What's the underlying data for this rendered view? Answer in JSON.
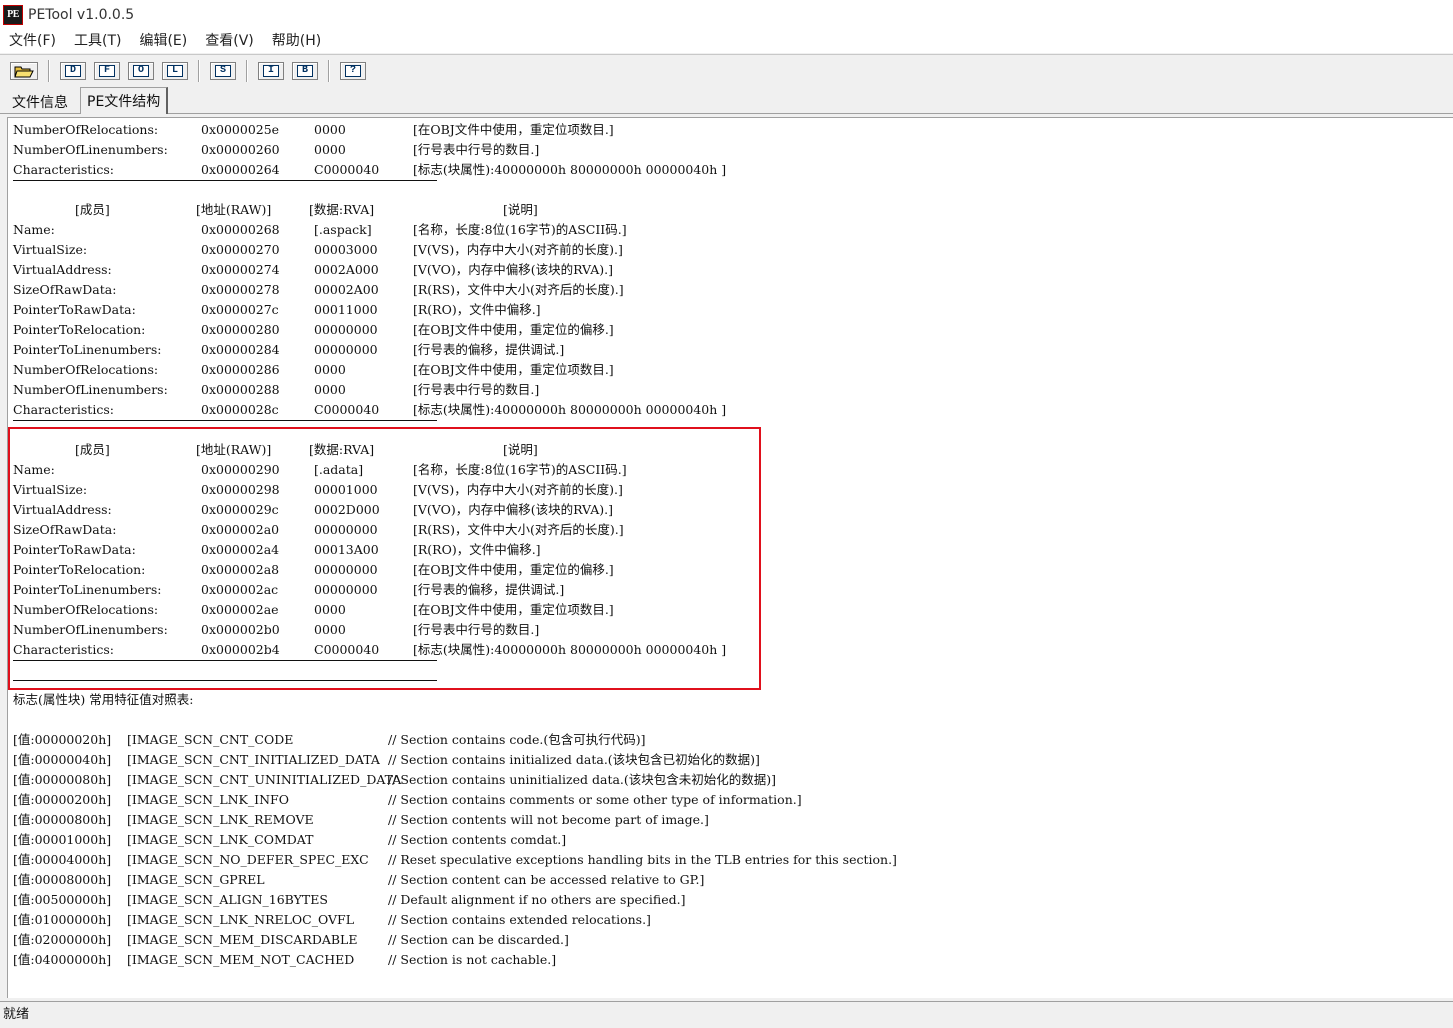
{
  "window": {
    "title": "PETool v1.0.0.5",
    "icon_text": "PE"
  },
  "menu": [
    "文件(F)",
    "工具(T)",
    "编辑(E)",
    "查看(V)",
    "帮助(H)"
  ],
  "toolbar": {
    "buttons": [
      "D",
      "F",
      "O",
      "L",
      "S",
      "I",
      "B",
      "?"
    ]
  },
  "tabs": [
    "文件信息",
    "PE文件结构"
  ],
  "content": {
    "pre_rows": [
      [
        "NumberOfRelocations:",
        "0x0000025e",
        "0000",
        "[在OBJ文件中使用，重定位项数目.]"
      ],
      [
        "NumberOfLinenumbers:",
        "0x00000260",
        "0000",
        "[行号表中行号的数目.]"
      ],
      [
        "Characteristics:",
        "0x00000264",
        "C0000040",
        "[标志(块属性):40000000h 80000000h 00000040h ]"
      ]
    ],
    "sections": [
      {
        "header": [
          "[成员]",
          "[地址(RAW)]",
          "[数据:RVA]",
          "[说明]"
        ],
        "rows": [
          [
            "Name:",
            "0x00000268",
            "[.aspack]",
            "[名称，长度:8位(16字节)的ASCII码.]"
          ],
          [
            "VirtualSize:",
            "0x00000270",
            "00003000",
            "[V(VS)，内存中大小(对齐前的长度).]"
          ],
          [
            "VirtualAddress:",
            "0x00000274",
            "0002A000",
            "[V(VO)，内存中偏移(该块的RVA).]"
          ],
          [
            "SizeOfRawData:",
            "0x00000278",
            "00002A00",
            "[R(RS)，文件中大小(对齐后的长度).]"
          ],
          [
            "PointerToRawData:",
            "0x0000027c",
            "00011000",
            "[R(RO)，文件中偏移.]"
          ],
          [
            "PointerToRelocation:",
            "0x00000280",
            "00000000",
            "[在OBJ文件中使用，重定位的偏移.]"
          ],
          [
            "PointerToLinenumbers:",
            "0x00000284",
            "00000000",
            "[行号表的偏移，提供调试.]"
          ],
          [
            "NumberOfRelocations:",
            "0x00000286",
            "0000",
            "[在OBJ文件中使用，重定位项数目.]"
          ],
          [
            "NumberOfLinenumbers:",
            "0x00000288",
            "0000",
            "[行号表中行号的数目.]"
          ],
          [
            "Characteristics:",
            "0x0000028c",
            "C0000040",
            "[标志(块属性):40000000h 80000000h 00000040h ]"
          ]
        ]
      },
      {
        "header": [
          "[成员]",
          "[地址(RAW)]",
          "[数据:RVA]",
          "[说明]"
        ],
        "rows": [
          [
            "Name:",
            "0x00000290",
            "[.adata]",
            "[名称，长度:8位(16字节)的ASCII码.]"
          ],
          [
            "VirtualSize:",
            "0x00000298",
            "00001000",
            "[V(VS)，内存中大小(对齐前的长度).]"
          ],
          [
            "VirtualAddress:",
            "0x0000029c",
            "0002D000",
            "[V(VO)，内存中偏移(该块的RVA).]"
          ],
          [
            "SizeOfRawData:",
            "0x000002a0",
            "00000000",
            "[R(RS)，文件中大小(对齐后的长度).]"
          ],
          [
            "PointerToRawData:",
            "0x000002a4",
            "00013A00",
            "[R(RO)，文件中偏移.]"
          ],
          [
            "PointerToRelocation:",
            "0x000002a8",
            "00000000",
            "[在OBJ文件中使用，重定位的偏移.]"
          ],
          [
            "PointerToLinenumbers:",
            "0x000002ac",
            "00000000",
            "[行号表的偏移，提供调试.]"
          ],
          [
            "NumberOfRelocations:",
            "0x000002ae",
            "0000",
            "[在OBJ文件中使用，重定位项数目.]"
          ],
          [
            "NumberOfLinenumbers:",
            "0x000002b0",
            "0000",
            "[行号表中行号的数目.]"
          ],
          [
            "Characteristics:",
            "0x000002b4",
            "C0000040",
            "[标志(块属性):40000000h 80000000h 00000040h ]"
          ]
        ]
      }
    ],
    "flags_title": "标志(属性块) 常用特征值对照表:",
    "flags": [
      [
        "[值:00000020h]",
        "[IMAGE_SCN_CNT_CODE",
        "// Section contains code.(包含可执行代码)]"
      ],
      [
        "[值:00000040h]",
        "[IMAGE_SCN_CNT_INITIALIZED_DATA",
        "// Section contains initialized data.(该块包含已初始化的数据)]"
      ],
      [
        "[值:00000080h]",
        "[IMAGE_SCN_CNT_UNINITIALIZED_DATA",
        "// Section contains uninitialized data.(该块包含未初始化的数据)]"
      ],
      [
        "[值:00000200h]",
        "[IMAGE_SCN_LNK_INFO",
        "// Section contains comments or some other type of information.]"
      ],
      [
        "[值:00000800h]",
        "[IMAGE_SCN_LNK_REMOVE",
        "// Section contents will not become part of image.]"
      ],
      [
        "[值:00001000h]",
        "[IMAGE_SCN_LNK_COMDAT",
        "// Section contents comdat.]"
      ],
      [
        "[值:00004000h]",
        "[IMAGE_SCN_NO_DEFER_SPEC_EXC",
        "// Reset speculative exceptions handling bits in the TLB entries for this section.]"
      ],
      [
        "[值:00008000h]",
        "[IMAGE_SCN_GPREL",
        "// Section content can be accessed relative to GP.]"
      ],
      [
        "[值:00500000h]",
        "[IMAGE_SCN_ALIGN_16BYTES",
        "// Default alignment if no others are specified.]"
      ],
      [
        "[值:01000000h]",
        "[IMAGE_SCN_LNK_NRELOC_OVFL",
        "// Section contains extended relocations.]"
      ],
      [
        "[值:02000000h]",
        "[IMAGE_SCN_MEM_DISCARDABLE",
        "// Section can be discarded.]"
      ],
      [
        "[值:04000000h]",
        "[IMAGE_SCN_MEM_NOT_CACHED",
        "// Section is not cachable.]"
      ]
    ]
  },
  "status": {
    "text": "就绪"
  }
}
